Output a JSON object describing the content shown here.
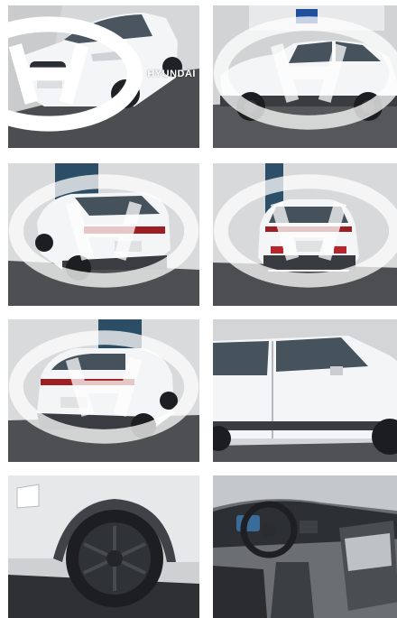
{
  "gallery": {
    "brand_wordmark": "HYUNDAI",
    "photos": [
      {
        "subject": "front-three-quarter"
      },
      {
        "subject": "side-profile-left"
      },
      {
        "subject": "rear-three-quarter-left"
      },
      {
        "subject": "rear"
      },
      {
        "subject": "rear-three-quarter-right"
      },
      {
        "subject": "side-doors-right"
      },
      {
        "subject": "wheel-detail"
      },
      {
        "subject": "interior-dashboard"
      }
    ],
    "colors": {
      "car_body": "#f3f4f5",
      "cladding": "#3a3d40",
      "wall": "#d9dadb",
      "pavement": "#4a4c4e",
      "watermark": "#ffffff"
    },
    "watermark_icon": "hyundai-logo-icon"
  }
}
